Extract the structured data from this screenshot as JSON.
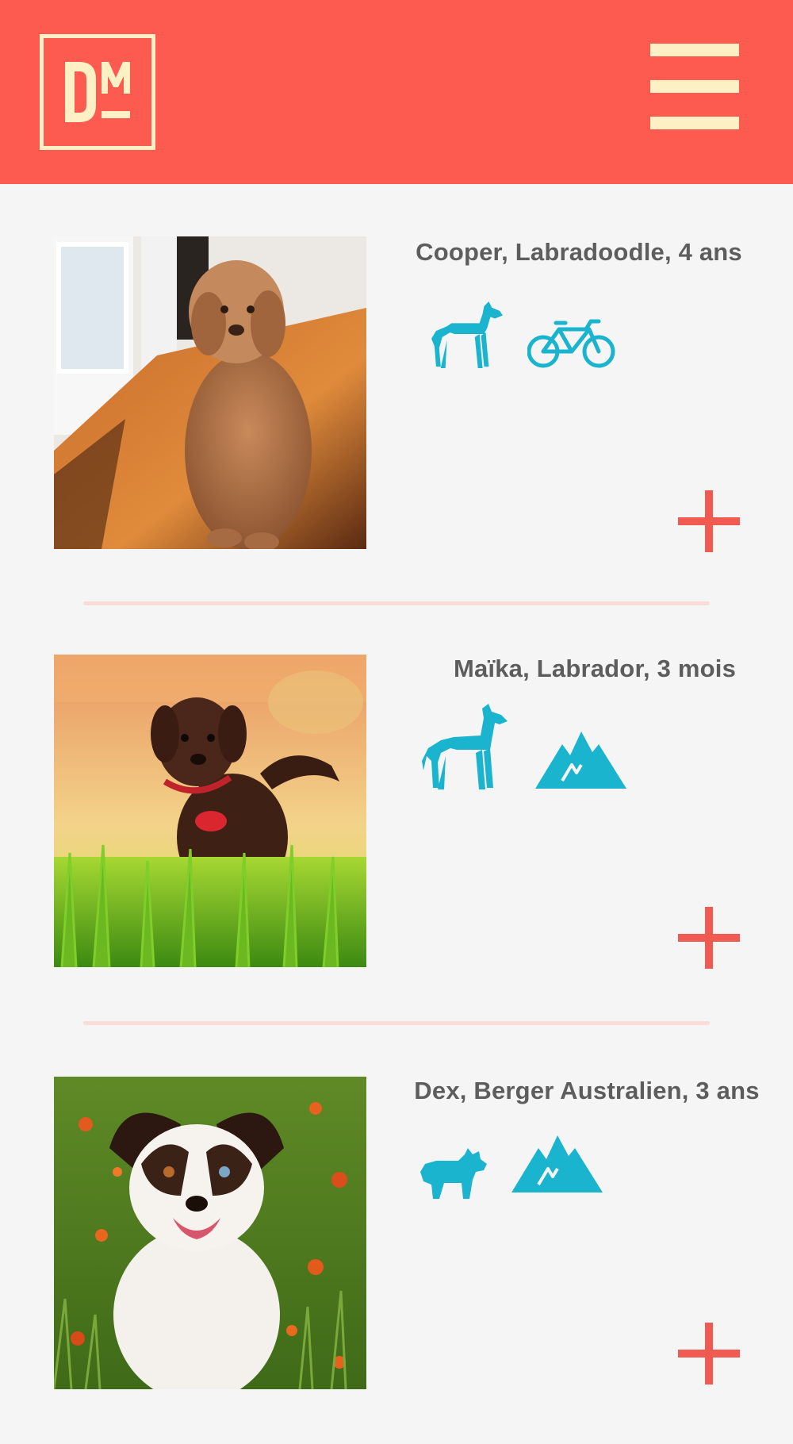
{
  "header": {
    "logo_text": "DM",
    "bg_color": "#fd5a50",
    "accent_color": "#fdf0c4",
    "menu_icon": "hamburger-menu-icon"
  },
  "colors": {
    "icon": "#1ab4cf",
    "plus": "#f05a50",
    "divider": "#fbdcd9",
    "title": "#5d5d5d"
  },
  "dogs": [
    {
      "title": "Cooper, Labradoodle, 4 ans",
      "icons": [
        "large-dog-icon",
        "bicycle-icon"
      ],
      "add_icon": "plus-icon"
    },
    {
      "title": "Maïka, Labrador, 3 mois",
      "icons": [
        "giant-dog-icon",
        "mountain-icon"
      ],
      "add_icon": "plus-icon"
    },
    {
      "title": "Dex, Berger Australien, 3 ans",
      "icons": [
        "small-dog-icon",
        "mountain-icon"
      ],
      "add_icon": "plus-icon"
    }
  ]
}
